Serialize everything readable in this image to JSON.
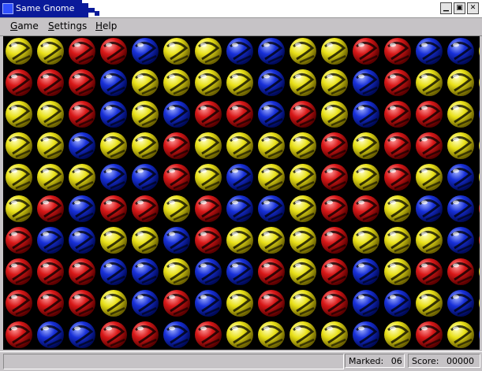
{
  "window": {
    "title": "Same Gnome"
  },
  "titlebar_buttons": [
    {
      "name": "minimize-button",
      "icon": "minimize-icon",
      "glyph": "▁"
    },
    {
      "name": "maximize-button",
      "icon": "maximize-icon",
      "glyph": "▣"
    },
    {
      "name": "close-button",
      "icon": "close-icon",
      "glyph": "✕"
    }
  ],
  "menu": [
    {
      "label": "Game",
      "hotkey": "G"
    },
    {
      "label": "Settings",
      "hotkey": "S"
    },
    {
      "label": "Help",
      "hotkey": "H"
    }
  ],
  "status": {
    "message": "",
    "marked_label": "Marked:",
    "marked_value": "06",
    "score_label": "Score:",
    "score_value": "00000"
  },
  "colors": {
    "red": "#d81818",
    "yellow": "#e8e018",
    "blue": "#1830d8",
    "board_bg": "#000000",
    "titlebar_accent": "#0a1a9a"
  },
  "board": {
    "columns": 15,
    "rows": 10,
    "grid": [
      [
        "Y",
        "Y",
        "R",
        "R",
        "B",
        "Y",
        "Y",
        "B",
        "B",
        "Y",
        "Y",
        "R",
        "R",
        "B",
        "B",
        "Y"
      ],
      [
        "R",
        "R",
        "R",
        "B",
        "Y",
        "Y",
        "Y",
        "Y",
        "B",
        "Y",
        "Y",
        "B",
        "R",
        "Y",
        "Y",
        "Y"
      ],
      [
        "Y",
        "Y",
        "R",
        "B",
        "Y",
        "B",
        "R",
        "R",
        "B",
        "R",
        "Y",
        "B",
        "R",
        "R",
        "Y",
        "B"
      ],
      [
        "Y",
        "Y",
        "B",
        "Y",
        "Y",
        "R",
        "Y",
        "Y",
        "Y",
        "Y",
        "R",
        "Y",
        "R",
        "R",
        "Y",
        "Y"
      ],
      [
        "Y",
        "Y",
        "Y",
        "B",
        "B",
        "R",
        "Y",
        "B",
        "Y",
        "Y",
        "R",
        "Y",
        "R",
        "Y",
        "B",
        "Y"
      ],
      [
        "Y",
        "R",
        "B",
        "R",
        "R",
        "Y",
        "R",
        "B",
        "B",
        "Y",
        "R",
        "R",
        "Y",
        "B",
        "B",
        "R"
      ],
      [
        "R",
        "B",
        "B",
        "Y",
        "Y",
        "B",
        "R",
        "Y",
        "Y",
        "Y",
        "R",
        "Y",
        "Y",
        "Y",
        "B",
        "R"
      ],
      [
        "R",
        "R",
        "R",
        "B",
        "B",
        "Y",
        "B",
        "B",
        "R",
        "Y",
        "R",
        "B",
        "Y",
        "R",
        "R",
        "Y"
      ],
      [
        "R",
        "R",
        "R",
        "Y",
        "B",
        "R",
        "B",
        "Y",
        "R",
        "Y",
        "R",
        "B",
        "B",
        "Y",
        "B",
        "Y"
      ],
      [
        "R",
        "B",
        "B",
        "R",
        "R",
        "B",
        "R",
        "Y",
        "Y",
        "Y",
        "Y",
        "B",
        "Y",
        "R",
        "Y",
        "B"
      ]
    ]
  }
}
